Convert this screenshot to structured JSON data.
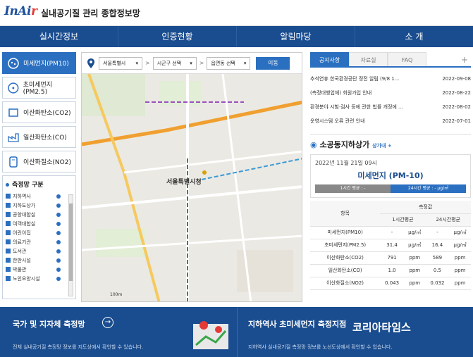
{
  "header": {
    "logo_main": "InAi",
    "logo_r": "r",
    "title": "실내공기질 관리 종합정보망"
  },
  "nav": [
    "실시간정보",
    "인증현황",
    "알림마당",
    "소   개"
  ],
  "pollutants": [
    {
      "label": "미세먼지(PM10)",
      "active": true
    },
    {
      "label": "초미세먼지(PM2.5)",
      "active": false
    },
    {
      "label": "이산화탄소(CO2)",
      "active": false
    },
    {
      "label": "일산화탄소(CO)",
      "active": false
    },
    {
      "label": "이산화질소(NO2)",
      "active": false
    }
  ],
  "categories": {
    "title": "측정망 구분",
    "items": [
      "지하역사",
      "지하도상가",
      "공항대합실",
      "여객대합실",
      "어린이집",
      "의료기관",
      "도서관",
      "한판시설",
      "박물관",
      "노인요양시설"
    ]
  },
  "map": {
    "city": "서울특별시",
    "district": "시군구 선택",
    "dong": "읍면동 선택",
    "go": "이동",
    "city_label": "서울특별시청",
    "scale": "100m"
  },
  "tabs": [
    "공지사항",
    "자료실",
    "FAQ"
  ],
  "notices": [
    {
      "title": "추석연휴 한국환경공단 정전 알림 (9/8 1...",
      "date": "2022-09-08"
    },
    {
      "title": "(측정대행업체) 회원가입 안내",
      "date": "2022-08-22"
    },
    {
      "title": "환경분야 시험·검사 등에 관한 법률 개정에 ...",
      "date": "2022-08-02"
    },
    {
      "title": "운영시스템 오류 관련 안내",
      "date": "2022-07-01"
    }
  ],
  "station": {
    "title": "소공동지하상가",
    "badge": "상가내 +",
    "date": "2022년 11월 21일 09시",
    "item": "미세먼지 (PM-10)",
    "bar1": "1시간 평균 : -",
    "bar2": "24시간 평균 : - μg/㎥"
  },
  "table": {
    "h1": "항목",
    "h2": "측정값",
    "h3": "1시간평균",
    "h4": "24시간평균",
    "rows": [
      [
        "미세먼지(PM10)",
        "-",
        "μg/㎥",
        "-",
        "μg/㎥"
      ],
      [
        "초미세먼지(PM2.5)",
        "31.4",
        "μg/㎥",
        "16.4",
        "μg/㎥"
      ],
      [
        "이산화탄소(CO2)",
        "791",
        "ppm",
        "589",
        "ppm"
      ],
      [
        "일산화탄소(CO)",
        "1.0",
        "ppm",
        "0.5",
        "ppm"
      ],
      [
        "이산화질소(NO2)",
        "0.043",
        "ppm",
        "0.032",
        "ppm"
      ]
    ]
  },
  "bottom": {
    "l_title": "국가 및 지자체 측정망",
    "l_sub": "전체 실내공기질 측정망 정보를 지도상에서 확인할 수 있습니다.",
    "r_title": "지하역사 초미세먼지 측정지점",
    "r_sub": "지하역사 실내공기질 측정망 정보를 노선도상에서 확인할 수 있습니다.",
    "watermark": "코리아타임스"
  }
}
